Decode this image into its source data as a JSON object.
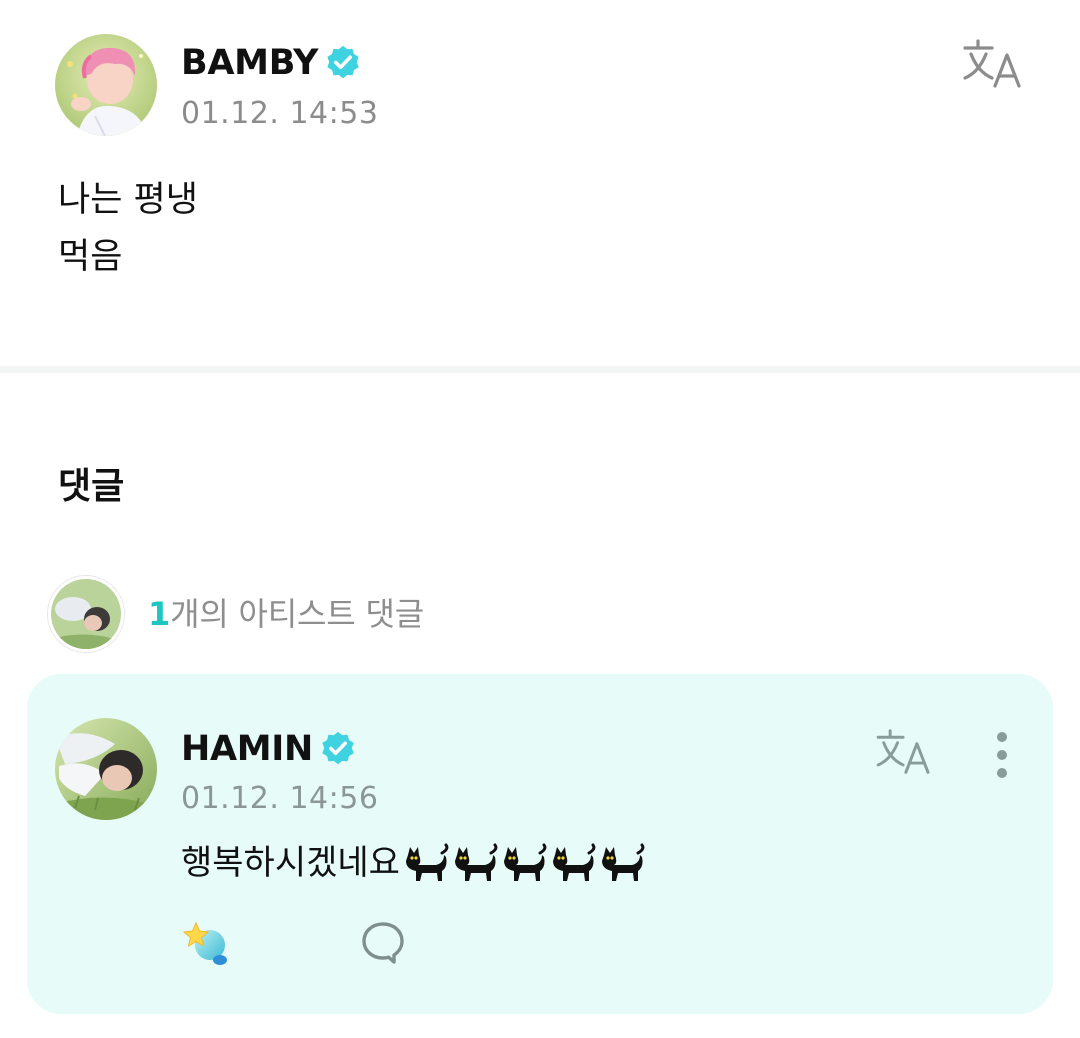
{
  "post": {
    "author_name": "BAMBY",
    "timestamp": "01.12. 14:53",
    "body_lines": [
      "나는 평냉",
      "먹음"
    ],
    "avatar_icon": "profile-avatar",
    "verified_icon": "verified-badge-icon",
    "translate_icon": "translate-icon"
  },
  "comments_section": {
    "title": "댓글",
    "artist_comment_count": "1",
    "artist_comment_suffix": "개의 아티스트 댓글"
  },
  "comment": {
    "author_name": "HAMIN",
    "timestamp": "01.12. 14:56",
    "text": "행복하시겠네요",
    "emoji_cat_count": 5,
    "emoji_icon": "black-cat-emoji",
    "reaction_icon": "sparkle-reaction-icon",
    "reply_icon": "speech-bubble-icon",
    "more_icon": "more-vertical-icon",
    "translate_icon": "translate-icon"
  },
  "colors": {
    "accent": "#1ec6c2",
    "verified": "#3fd2e0",
    "comment_card_bg": "#e7fbf8",
    "timestamp_gray": "#8c8c8c",
    "divider": "#f4f5f5"
  }
}
